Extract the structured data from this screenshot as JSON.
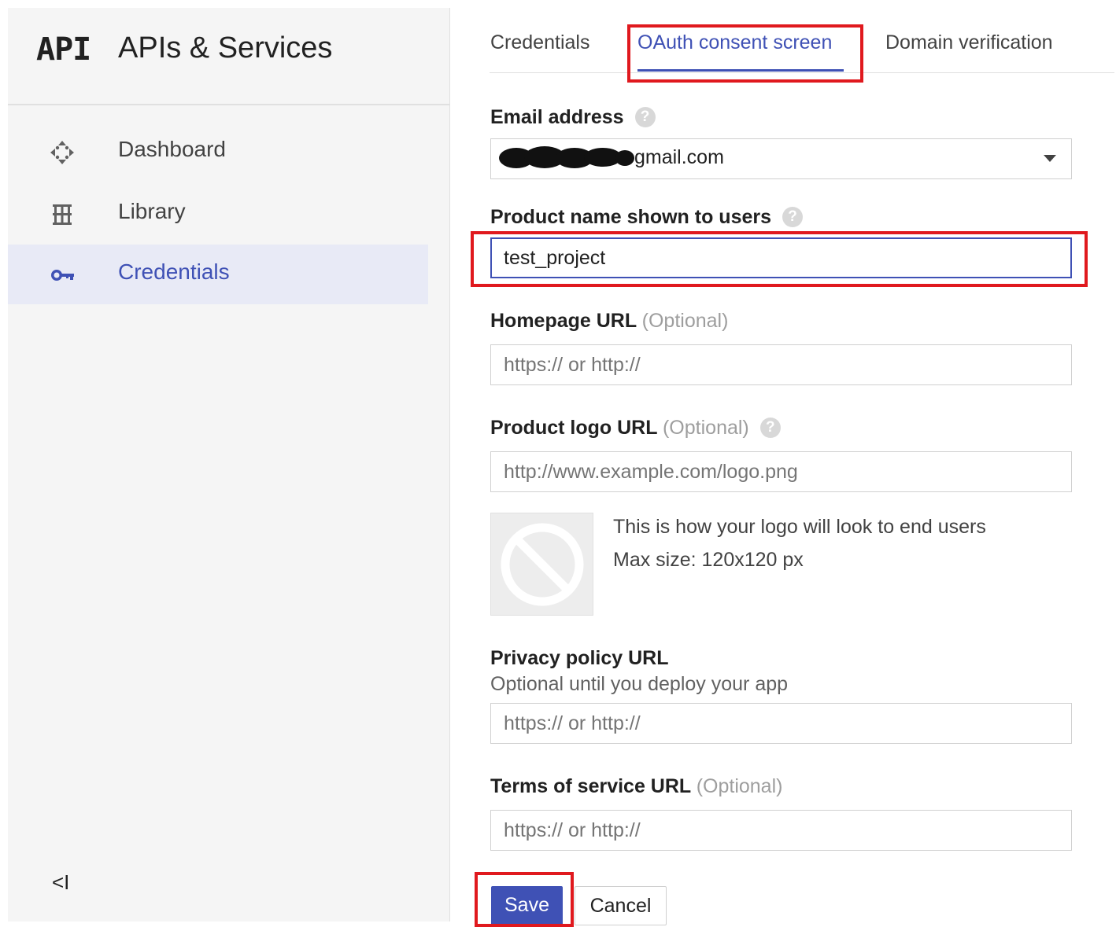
{
  "sidebar": {
    "logo": "API",
    "title": "APIs & Services",
    "items": [
      {
        "label": "Dashboard",
        "icon": "dashboard-icon",
        "active": false
      },
      {
        "label": "Library",
        "icon": "library-icon",
        "active": false
      },
      {
        "label": "Credentials",
        "icon": "key-icon",
        "active": true
      }
    ],
    "collapse_glyph": "<I"
  },
  "tabs": [
    {
      "label": "Credentials",
      "active": false
    },
    {
      "label": "OAuth consent screen",
      "active": true
    },
    {
      "label": "Domain verification",
      "active": false
    }
  ],
  "form": {
    "email": {
      "label": "Email address",
      "value_suffix": "gmail.com"
    },
    "product_name": {
      "label": "Product name shown to users",
      "value": "test_project"
    },
    "homepage": {
      "label": "Homepage URL",
      "optional": "(Optional)",
      "placeholder": "https:// or http://"
    },
    "logo_url": {
      "label": "Product logo URL",
      "optional": "(Optional)",
      "placeholder": "http://www.example.com/logo.png"
    },
    "logo_note": {
      "line1": "This is how your logo will look to end users",
      "line2": "Max size: 120x120 px"
    },
    "privacy": {
      "label": "Privacy policy URL",
      "note": "Optional until you deploy your app",
      "placeholder": "https:// or http://"
    },
    "terms": {
      "label": "Terms of service URL",
      "optional": "(Optional)",
      "placeholder": "https:// or http://"
    },
    "help_glyph": "?"
  },
  "buttons": {
    "save": "Save",
    "cancel": "Cancel"
  },
  "colors": {
    "accent": "#3f51b5",
    "highlight": "#e0191e",
    "sidebar_bg": "#f5f5f5",
    "active_bg": "#e8eaf6"
  }
}
